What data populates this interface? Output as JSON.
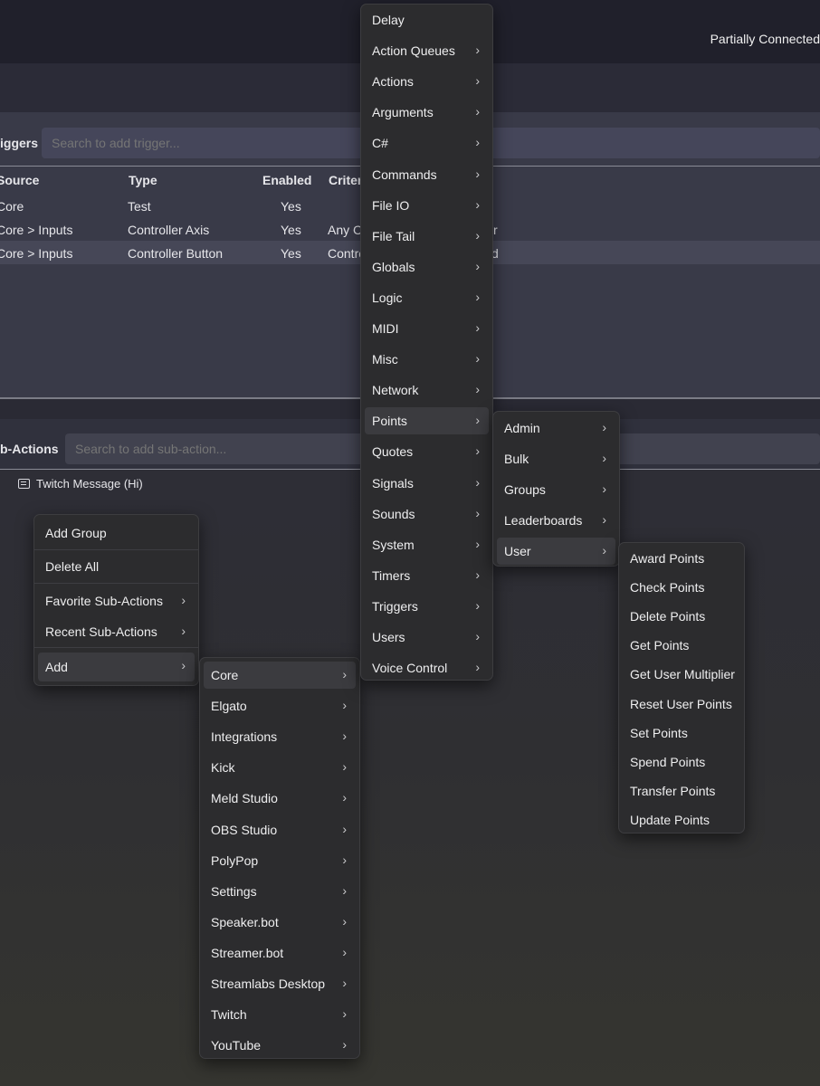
{
  "status": "Partially Connected",
  "triggers": {
    "label": "iggers",
    "search_placeholder": "Search to add trigger...",
    "columns": [
      "Source",
      "Type",
      "Enabled",
      "Criter"
    ],
    "rows": [
      {
        "source": "Core",
        "type": "Test",
        "enabled": "Yes",
        "criteria": "",
        "tail": ""
      },
      {
        "source": "Core > Inputs",
        "type": "Controller Axis",
        "enabled": "Yes",
        "criteria": "Any C",
        "tail": "r"
      },
      {
        "source": "Core > Inputs",
        "type": "Controller Button",
        "enabled": "Yes",
        "criteria": "Contro",
        "tail": "d"
      }
    ]
  },
  "subactions": {
    "label": "b-Actions",
    "search_placeholder": "Search to add sub-action...",
    "items": [
      "Twitch Message (Hi)"
    ]
  },
  "context_menu": {
    "group1": [
      "Add Group",
      "Delete All"
    ],
    "group2": [
      "Favorite Sub-Actions",
      "Recent Sub-Actions"
    ],
    "group3": [
      "Add"
    ]
  },
  "add_menu": [
    "Core",
    "Elgato",
    "Integrations",
    "Kick",
    "Meld Studio",
    "OBS Studio",
    "PolyPop",
    "Settings",
    "Speaker.bot",
    "Streamer.bot",
    "Streamlabs Desktop",
    "Twitch",
    "YouTube"
  ],
  "core_menu": [
    "Delay",
    "Action Queues",
    "Actions",
    "Arguments",
    "C#",
    "Commands",
    "File IO",
    "File Tail",
    "Globals",
    "Logic",
    "MIDI",
    "Misc",
    "Network",
    "Points",
    "Quotes",
    "Signals",
    "Sounds",
    "System",
    "Timers",
    "Triggers",
    "Users",
    "Voice Control"
  ],
  "points_menu": [
    "Admin",
    "Bulk",
    "Groups",
    "Leaderboards",
    "User"
  ],
  "user_menu": [
    "Award Points",
    "Check Points",
    "Delete Points",
    "Get Points",
    "Get User Multiplier",
    "Reset User Points",
    "Set Points",
    "Spend Points",
    "Transfer Points",
    "Update Points"
  ],
  "chevron": "›"
}
